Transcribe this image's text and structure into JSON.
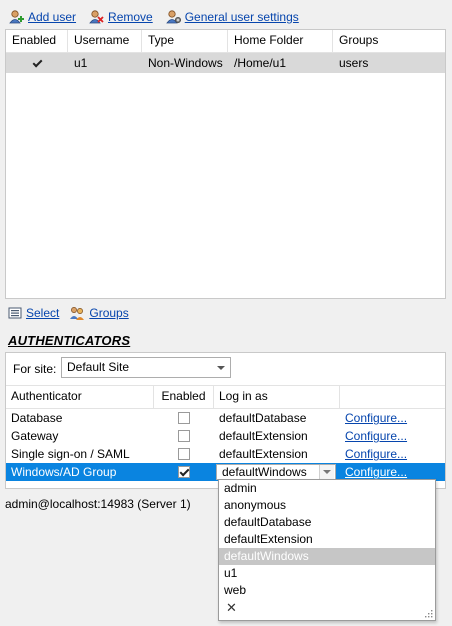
{
  "toolbar": {
    "add_user": "Add user",
    "remove": "Remove",
    "general_settings": "General user settings"
  },
  "users_table": {
    "columns": [
      "Enabled",
      "Username",
      "Type",
      "Home Folder",
      "Groups"
    ],
    "rows": [
      {
        "enabled": true,
        "username": "u1",
        "type": "Non-Windows",
        "home_folder": "/Home/u1",
        "groups": "users"
      }
    ]
  },
  "links": {
    "select": "Select",
    "groups": "Groups"
  },
  "authenticators": {
    "title": "AUTHENTICATORS",
    "for_site_label": "For site:",
    "site_value": "Default Site",
    "columns": [
      "Authenticator",
      "Enabled",
      "Log in as",
      ""
    ],
    "rows": [
      {
        "name": "Database",
        "enabled": false,
        "login_as": "defaultDatabase",
        "action": "Configure..."
      },
      {
        "name": "Gateway",
        "enabled": false,
        "login_as": "defaultExtension",
        "action": "Configure..."
      },
      {
        "name": "Single sign-on / SAML",
        "enabled": false,
        "login_as": "defaultExtension",
        "action": "Configure..."
      },
      {
        "name": "Windows/AD Group",
        "enabled": true,
        "login_as": "defaultWindows",
        "action": "Configure...",
        "selected": true
      }
    ]
  },
  "status_bar": "admin@localhost:14983 (Server 1)",
  "login_dropdown": {
    "options": [
      "admin",
      "anonymous",
      "defaultDatabase",
      "defaultExtension",
      "defaultWindows",
      "u1",
      "web"
    ],
    "highlighted": "defaultWindows",
    "clear_symbol": "✕"
  },
  "colors": {
    "selection": "#0a84e0",
    "link": "#0645ad",
    "highlight": "#c6c6c6"
  }
}
